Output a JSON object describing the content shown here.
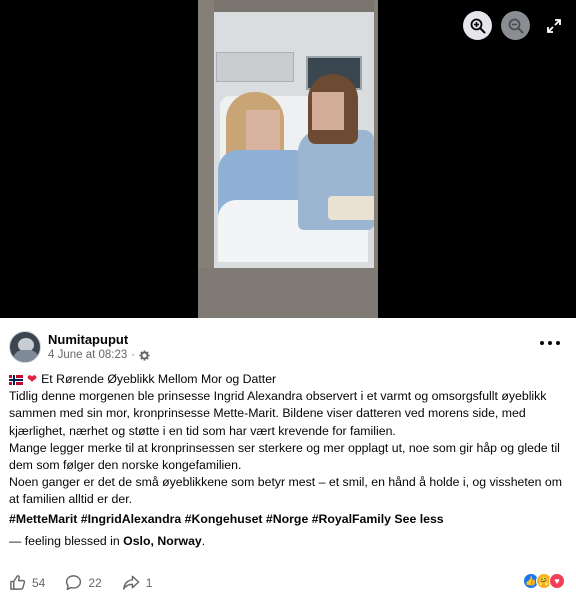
{
  "viewer": {
    "zoom_in_icon": "zoom-in-icon",
    "zoom_out_icon": "zoom-out-icon",
    "expand_icon": "expand-icon"
  },
  "post": {
    "author": "Numitapuput",
    "timestamp": "4 June at 08:23",
    "separator": "·",
    "audience_icon": "gear-icon",
    "headline": "Et Rørende Øyeblikk Mellom Mor og Datter",
    "paragraphs": [
      "Tidlig denne morgenen ble prinsesse Ingrid Alexandra observert i et varmt og omsorgsfullt øyeblikk sammen med sin mor, kronprinsesse Mette-Marit. Bildene viser datteren ved morens side, med kjærlighet, nærhet og støtte i en tid som har vært krevende for familien.",
      "Mange legger merke til at kronprinsessen ser sterkere og mer opplagt ut, noe som gir håp og glede til dem som følger den norske kongefamilien.",
      "Noen ganger er det de små øyeblikkene som betyr mest – et smil, en hånd å holde i, og vissheten om at familien alltid er der."
    ],
    "hashtags": "#MetteMarit #IngridAlexandra #Kongehuset #Norge #RoyalFamily",
    "see_less": "See less",
    "feeling_prefix": "— feeling blessed in ",
    "location": "Oslo, Norway",
    "feeling_suffix": "."
  },
  "actions": {
    "likes": "54",
    "comments": "22",
    "shares": "1"
  },
  "colors": {
    "text": "#050505",
    "meta": "#65676b",
    "like_blue": "#1877f2",
    "love_red": "#f33e58",
    "care_yellow": "#f7b125"
  }
}
